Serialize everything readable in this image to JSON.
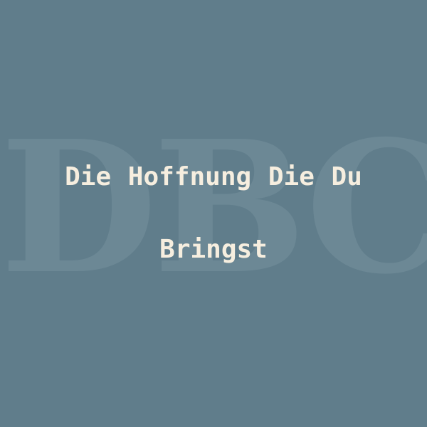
{
  "watermark": {
    "text": "DBC",
    "color": "#6e8a97"
  },
  "title": {
    "line1": "Die Hoffnung Die Du",
    "line2": "Bringst"
  },
  "colors": {
    "background": "#607d8b",
    "text": "#f6eedf"
  }
}
